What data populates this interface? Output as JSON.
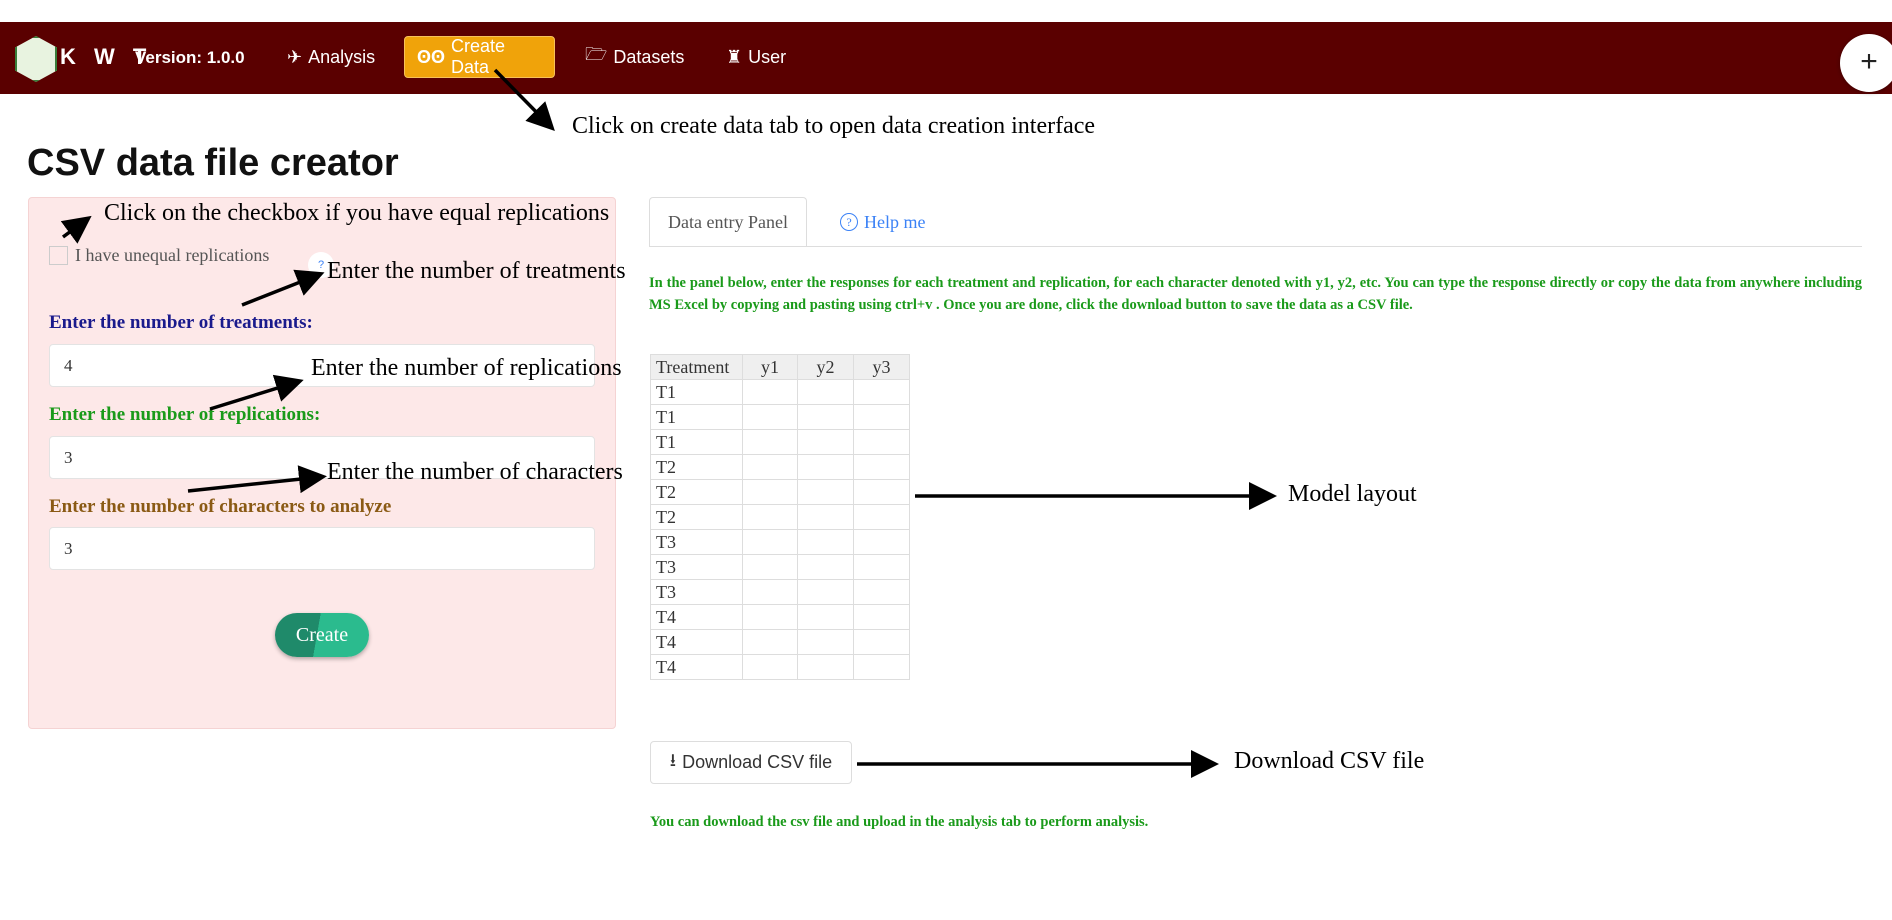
{
  "nav": {
    "brand": "K W T",
    "version": "Version: 1.0.0",
    "items": [
      {
        "label": "Analysis",
        "icon": "paper-plane-icon"
      },
      {
        "label": "Create Data",
        "icon": "binoculars-icon",
        "active": true
      },
      {
        "label": "Datasets",
        "icon": "folder-open-icon"
      },
      {
        "label": "User",
        "icon": "user-icon"
      }
    ],
    "plus": "+"
  },
  "page": {
    "title": "CSV data file creator"
  },
  "form": {
    "checkbox_label": "I have unequal replications",
    "checked": false,
    "treatments_label": "Enter the number of treatments:",
    "treatments_value": "4",
    "replications_label": "Enter the number of replications:",
    "replications_value": "3",
    "characters_label": "Enter the number of characters to analyze",
    "characters_value": "3",
    "create_label": "Create",
    "colors": {
      "treatments": "#1a1a8c",
      "replications": "#1a9a1a",
      "characters": "#8a5a14"
    }
  },
  "tabs": [
    {
      "label": "Data entry Panel"
    },
    {
      "label": "Help me",
      "icon": "question-circle-icon"
    }
  ],
  "instructions": "In the panel below, enter the responses for each treatment and replication, for each character denoted with y1, y2, etc. You can type the response directly or copy the data from anywhere including MS Excel by copying and pasting using ctrl+v . Once you are done, click the download button to save the data as a CSV file.",
  "table": {
    "headers": [
      "Treatment",
      "y1",
      "y2",
      "y3"
    ],
    "rows": [
      "T1",
      "T1",
      "T1",
      "T2",
      "T2",
      "T2",
      "T3",
      "T3",
      "T3",
      "T4",
      "T4",
      "T4"
    ]
  },
  "download_label": "Download CSV file",
  "footer_note": "You can download the csv file and upload in the analysis tab to perform analysis.",
  "annotations": {
    "create_tab": "Click on create data tab to open data creation interface",
    "checkbox": "Click on the checkbox if you have equal replications",
    "treatments": "Enter the number of treatments",
    "replications": "Enter the number of replications",
    "characters": "Enter the number of characters",
    "model": "Model layout",
    "download": "Download CSV file"
  }
}
